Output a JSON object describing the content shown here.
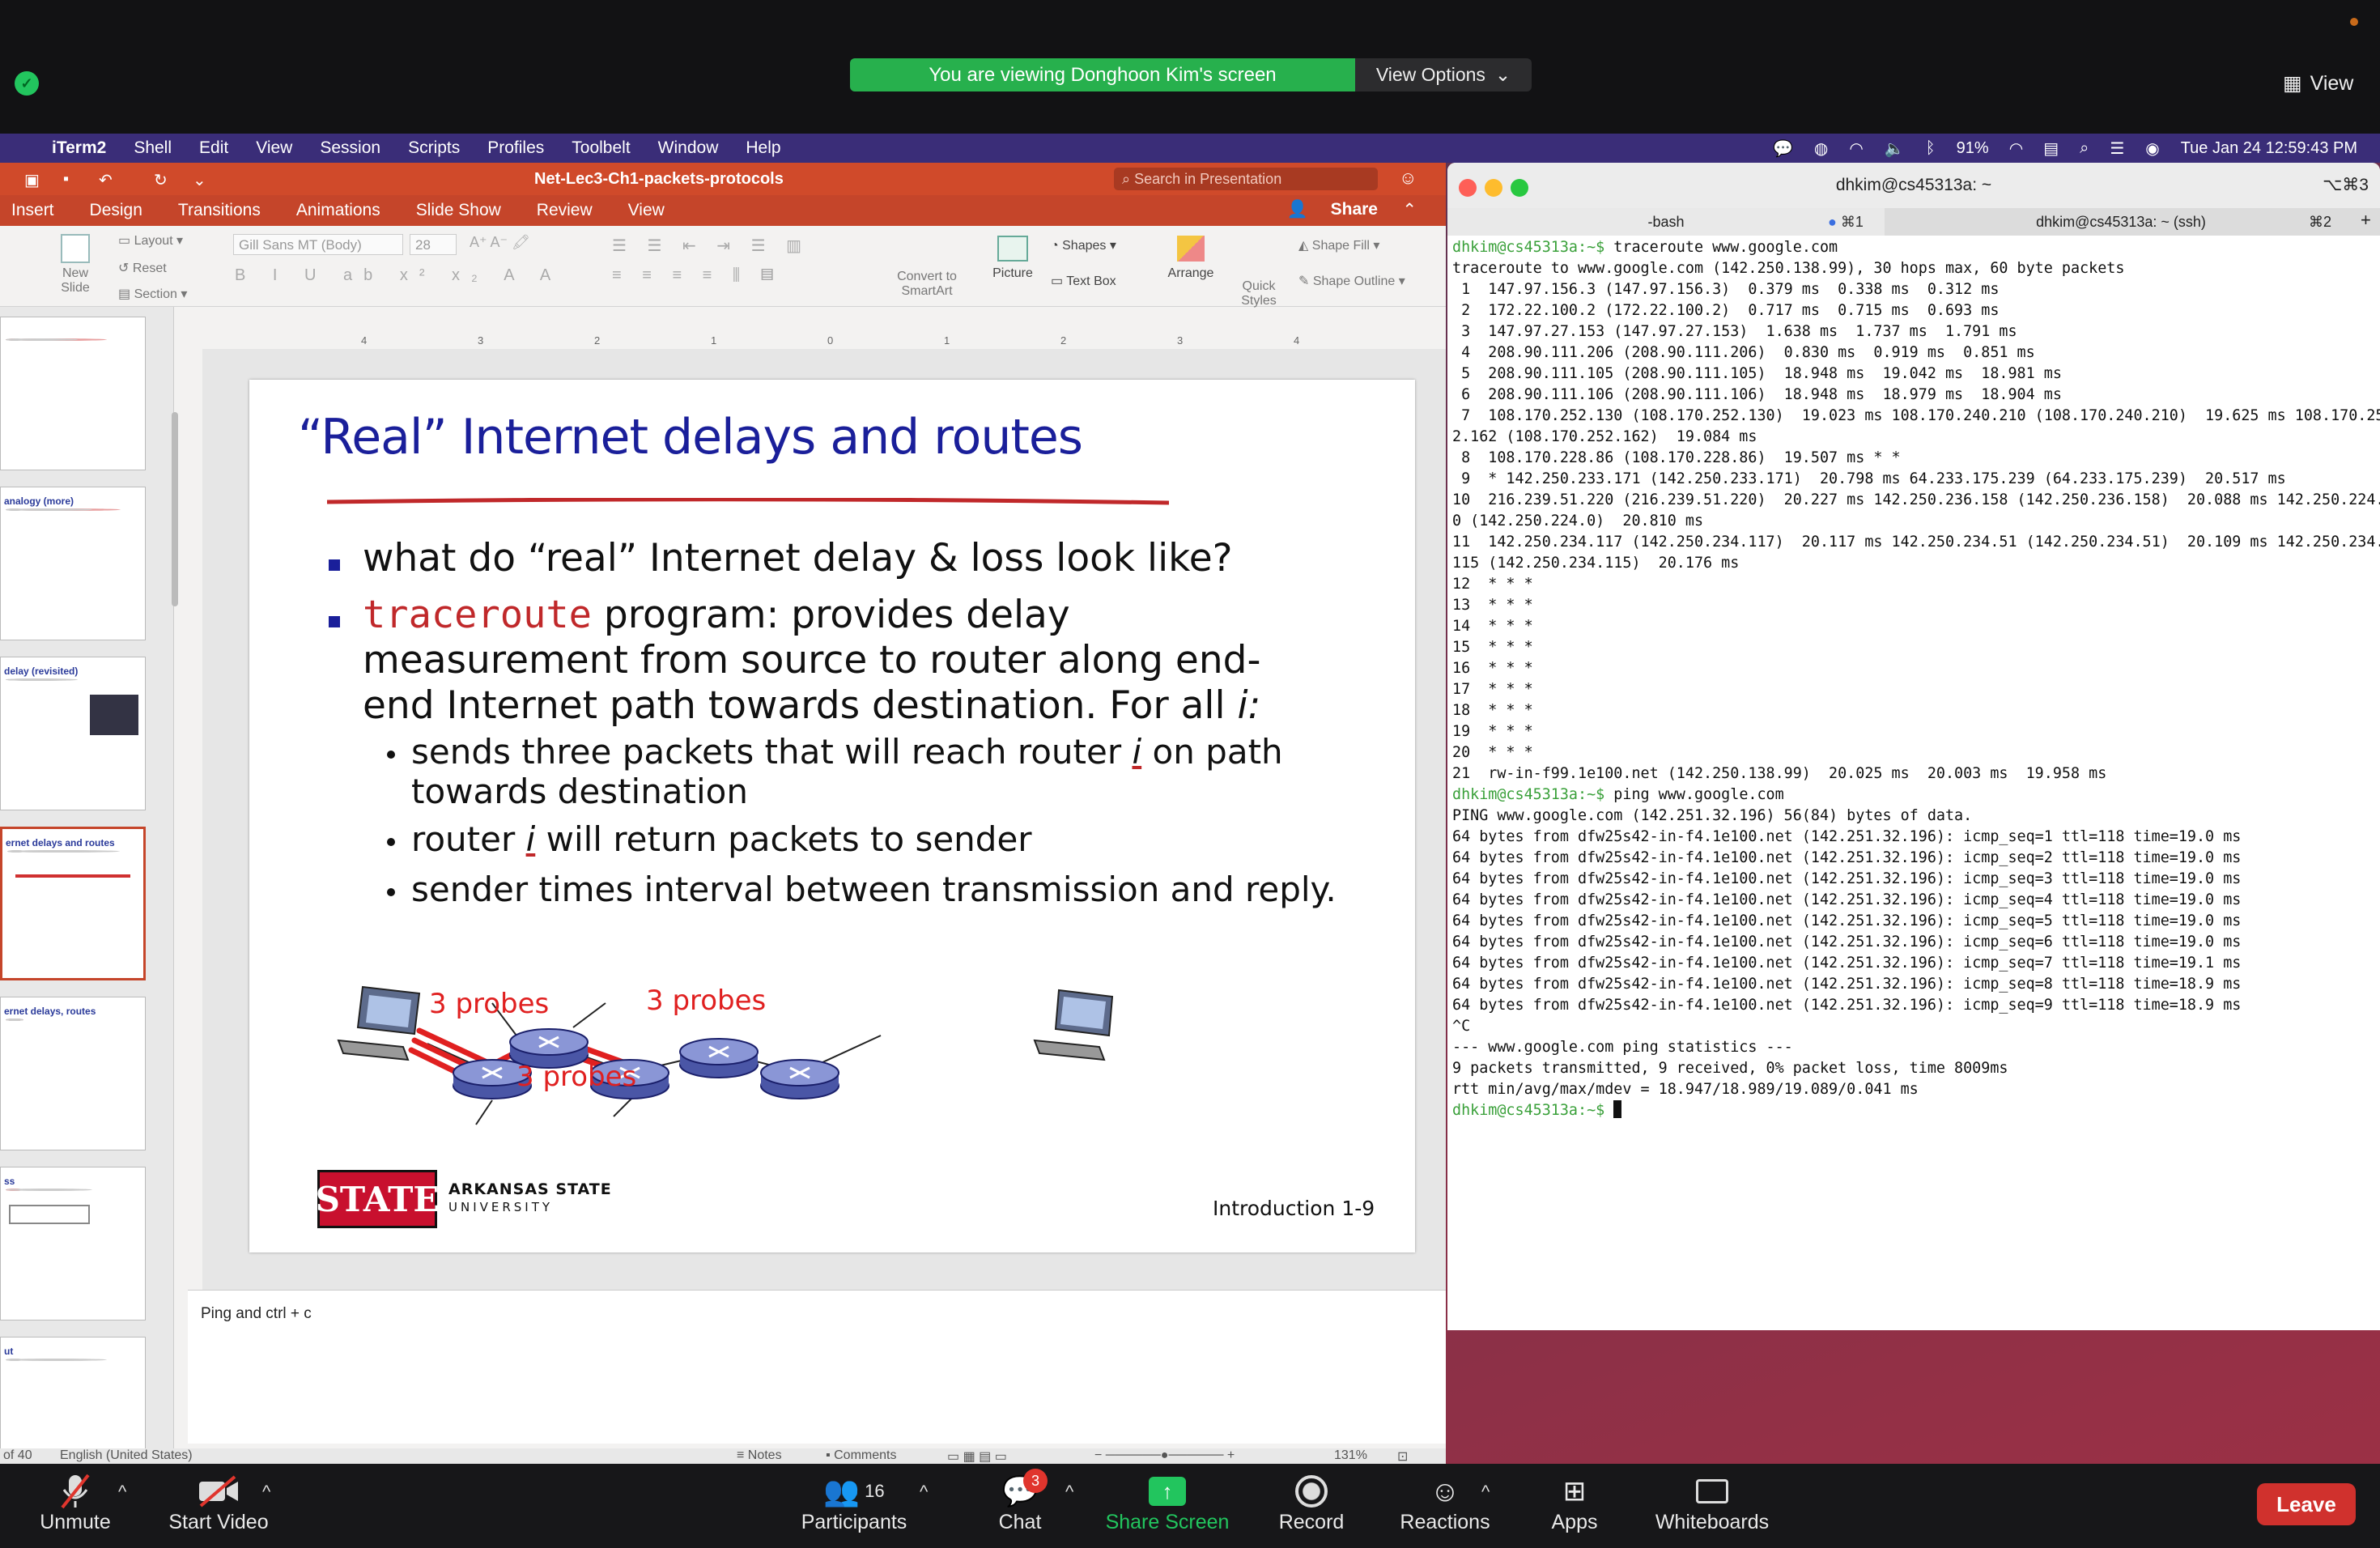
{
  "zoom": {
    "banner": "You are viewing Donghoon Kim's screen",
    "view_options": "View Options",
    "view": "View",
    "toolbar": {
      "unmute": "Unmute",
      "start_video": "Start Video",
      "participants": "Participants",
      "participants_count": "16",
      "chat": "Chat",
      "chat_badge": "3",
      "share_screen": "Share Screen",
      "record": "Record",
      "reactions": "Reactions",
      "apps": "Apps",
      "whiteboards": "Whiteboards",
      "leave": "Leave"
    }
  },
  "menubar": {
    "items": [
      "iTerm2",
      "Shell",
      "Edit",
      "View",
      "Session",
      "Scripts",
      "Profiles",
      "Toolbelt",
      "Window",
      "Help"
    ],
    "battery": "91%",
    "datetime": "Tue Jan 24  12:59:43 PM"
  },
  "ppt": {
    "filename": "Net-Lec3-Ch1-packets-protocols",
    "search_placeholder": "Search in Presentation",
    "share": "Share",
    "tabs": [
      "Insert",
      "Design",
      "Transitions",
      "Animations",
      "Slide Show",
      "Review",
      "View"
    ],
    "ribbon": {
      "new_slide": "New Slide",
      "layout": "Layout",
      "reset": "Reset",
      "section": "Section",
      "font": "Gill Sans MT (Body)",
      "font_size": "28",
      "convert": "Convert to SmartArt",
      "picture": "Picture",
      "shapes": "Shapes",
      "text_box": "Text Box",
      "arrange": "Arrange",
      "quick_styles": "Quick Styles",
      "shape_fill": "Shape Fill",
      "shape_outline": "Shape Outline"
    },
    "ruler_ticks": [
      "4",
      "3",
      "2",
      "1",
      "0",
      "1",
      "2",
      "3",
      "4"
    ],
    "thumbnails": [
      {
        "title": ""
      },
      {
        "title": "analogy (more)"
      },
      {
        "title": "delay (revisited)"
      },
      {
        "title": "ernet delays and routes"
      },
      {
        "title": "ernet delays, routes"
      },
      {
        "title": "ss"
      },
      {
        "title": "ut"
      }
    ],
    "notes": "Ping and ctrl + c",
    "status": {
      "slide_of": "of 40",
      "language": "English (United States)",
      "notes": "Notes",
      "comments": "Comments",
      "zoom": "131%"
    }
  },
  "slide": {
    "title": "“Real” Internet delays and routes",
    "bullet1": "what do “real” Internet delay & loss look like?",
    "bullet2_code": "traceroute",
    "bullet2_line1": " program: provides delay",
    "bullet2_line2": "measurement from source to router along end-",
    "bullet2_line3": "end Internet path towards destination.  For all ",
    "bullet2_i": "i:",
    "sub1_a": "sends three packets that will reach router ",
    "sub1_i": "i",
    "sub1_b": " on path",
    "sub1_line2": "towards destination",
    "sub2_a": "router ",
    "sub2_i": "i",
    "sub2_b": " will return packets to sender",
    "sub3": "sender times interval between transmission and reply.",
    "probe1": "3 probes",
    "probe2": "3 probes",
    "probe3": "3 probes",
    "logo_main": "ARKANSAS STATE",
    "logo_sub": "UNIVERSITY",
    "logo_mark": "STATE",
    "footer": "Introduction 1-9"
  },
  "terminal": {
    "title": "dhkim@cs45313a: ~",
    "shortcut": "⌥⌘3",
    "tab1": "-bash",
    "tab1_key": "⌘1",
    "tab2": "dhkim@cs45313a: ~ (ssh)",
    "tab2_key": "⌘2",
    "prompt": "dhkim@cs45313a:~$",
    "lines": [
      {
        "p": true,
        "t": " traceroute www.google.com"
      },
      {
        "t": "traceroute to www.google.com (142.250.138.99), 30 hops max, 60 byte packets"
      },
      {
        "t": " 1  147.97.156.3 (147.97.156.3)  0.379 ms  0.338 ms  0.312 ms"
      },
      {
        "t": " 2  172.22.100.2 (172.22.100.2)  0.717 ms  0.715 ms  0.693 ms"
      },
      {
        "t": " 3  147.97.27.153 (147.97.27.153)  1.638 ms  1.737 ms  1.791 ms"
      },
      {
        "t": " 4  208.90.111.206 (208.90.111.206)  0.830 ms  0.919 ms  0.851 ms"
      },
      {
        "t": " 5  208.90.111.105 (208.90.111.105)  18.948 ms  19.042 ms  18.981 ms"
      },
      {
        "t": " 6  208.90.111.106 (208.90.111.106)  18.948 ms  18.979 ms  18.904 ms"
      },
      {
        "t": " 7  108.170.252.130 (108.170.252.130)  19.023 ms 108.170.240.210 (108.170.240.210)  19.625 ms 108.170.25"
      },
      {
        "t": "2.162 (108.170.252.162)  19.084 ms"
      },
      {
        "t": " 8  108.170.228.86 (108.170.228.86)  19.507 ms * *"
      },
      {
        "t": " 9  * 142.250.233.171 (142.250.233.171)  20.798 ms 64.233.175.239 (64.233.175.239)  20.517 ms"
      },
      {
        "t": "10  216.239.51.220 (216.239.51.220)  20.227 ms 142.250.236.158 (142.250.236.158)  20.088 ms 142.250.224."
      },
      {
        "t": "0 (142.250.224.0)  20.810 ms"
      },
      {
        "t": "11  142.250.234.117 (142.250.234.117)  20.117 ms 142.250.234.51 (142.250.234.51)  20.109 ms 142.250.234."
      },
      {
        "t": "115 (142.250.234.115)  20.176 ms"
      },
      {
        "t": "12  * * *"
      },
      {
        "t": "13  * * *"
      },
      {
        "t": "14  * * *"
      },
      {
        "t": "15  * * *"
      },
      {
        "t": "16  * * *"
      },
      {
        "t": "17  * * *"
      },
      {
        "t": "18  * * *"
      },
      {
        "t": "19  * * *"
      },
      {
        "t": "20  * * *"
      },
      {
        "t": "21  rw-in-f99.1e100.net (142.250.138.99)  20.025 ms  20.003 ms  19.958 ms"
      },
      {
        "p": true,
        "t": " ping www.google.com"
      },
      {
        "t": "PING www.google.com (142.251.32.196) 56(84) bytes of data."
      },
      {
        "t": "64 bytes from dfw25s42-in-f4.1e100.net (142.251.32.196): icmp_seq=1 ttl=118 time=19.0 ms"
      },
      {
        "t": "64 bytes from dfw25s42-in-f4.1e100.net (142.251.32.196): icmp_seq=2 ttl=118 time=19.0 ms"
      },
      {
        "t": "64 bytes from dfw25s42-in-f4.1e100.net (142.251.32.196): icmp_seq=3 ttl=118 time=19.0 ms"
      },
      {
        "t": "64 bytes from dfw25s42-in-f4.1e100.net (142.251.32.196): icmp_seq=4 ttl=118 time=19.0 ms"
      },
      {
        "t": "64 bytes from dfw25s42-in-f4.1e100.net (142.251.32.196): icmp_seq=5 ttl=118 time=19.0 ms"
      },
      {
        "t": "64 bytes from dfw25s42-in-f4.1e100.net (142.251.32.196): icmp_seq=6 ttl=118 time=19.0 ms"
      },
      {
        "t": "64 bytes from dfw25s42-in-f4.1e100.net (142.251.32.196): icmp_seq=7 ttl=118 time=19.1 ms"
      },
      {
        "t": "64 bytes from dfw25s42-in-f4.1e100.net (142.251.32.196): icmp_seq=8 ttl=118 time=18.9 ms"
      },
      {
        "t": "64 bytes from dfw25s42-in-f4.1e100.net (142.251.32.196): icmp_seq=9 ttl=118 time=18.9 ms"
      },
      {
        "t": "^C"
      },
      {
        "t": "--- www.google.com ping statistics ---"
      },
      {
        "t": "9 packets transmitted, 9 received, 0% packet loss, time 8009ms"
      },
      {
        "t": "rtt min/avg/max/mdev = 18.947/18.989/19.089/0.041 ms"
      },
      {
        "p": true,
        "t": " ",
        "cursor": true
      }
    ]
  }
}
